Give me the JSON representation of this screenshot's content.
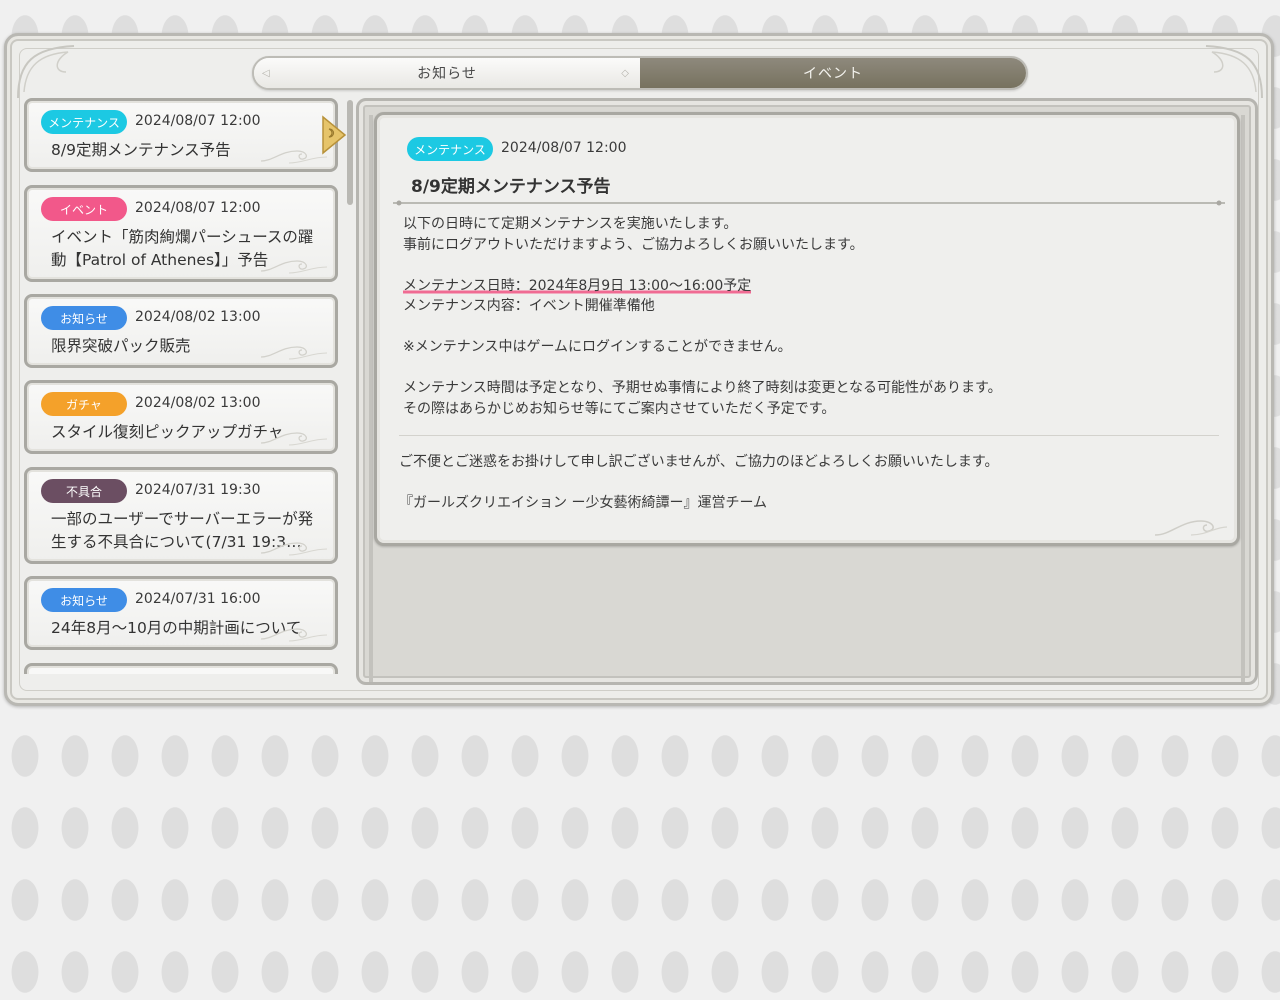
{
  "tabs": [
    {
      "label": "お知らせ",
      "active": false
    },
    {
      "label": "イベント",
      "active": true
    }
  ],
  "category_colors": {
    "メンテナンス": "#1cc9e3",
    "イベント": "#f2588a",
    "お知らせ": "#3f8de6",
    "ガチャ": "#f4a12a",
    "不具合": "#6b4e62"
  },
  "news_list": [
    {
      "category": "メンテナンス",
      "date": "2024/08/07 12:00",
      "title": "8/9定期メンテナンス予告",
      "selected": true
    },
    {
      "category": "イベント",
      "date": "2024/08/07 12:00",
      "title": "イベント「筋肉絢爛パーシュースの躍動【Patrol of Athenes】」予告"
    },
    {
      "category": "お知らせ",
      "date": "2024/08/02 13:00",
      "title": "限界突破パック販売"
    },
    {
      "category": "ガチャ",
      "date": "2024/08/02 13:00",
      "title": "スタイル復刻ピックアップガチャ"
    },
    {
      "category": "不具合",
      "date": "2024/07/31 19:30",
      "title": "一部のユーザーでサーバーエラーが発生する不具合について(7/31 19:3…"
    },
    {
      "category": "お知らせ",
      "date": "2024/07/31 16:00",
      "title": "24年8月〜10月の中期計画について"
    }
  ],
  "detail": {
    "category": "メンテナンス",
    "date": "2024/08/07 12:00",
    "title": "8/9定期メンテナンス予告",
    "body": [
      "以下の日時にて定期メンテナンスを実施いたします。",
      "事前にログアウトいただけますよう、ご協力よろしくお願いいたします。",
      "",
      "メンテナンス日時：2024年8月9日 13:00〜16:00予定",
      "メンテナンス内容：イベント開催準備他",
      "",
      "※メンテナンス中はゲームにログインすることができません。",
      "",
      "メンテナンス時間は予定となり、予期せぬ事情により終了時刻は変更となる可能性があります。",
      "その際はあらかじめお知らせ等にてご案内させていただく予定です。"
    ],
    "highlight_line_index": 3,
    "footer": [
      "ご不便とご迷惑をお掛けして申し訳ございませんが、ご協力のほどよろしくお願いいたします。",
      "",
      "『ガールズクリエイション ー少女藝術綺譚ー』運営チーム"
    ]
  }
}
